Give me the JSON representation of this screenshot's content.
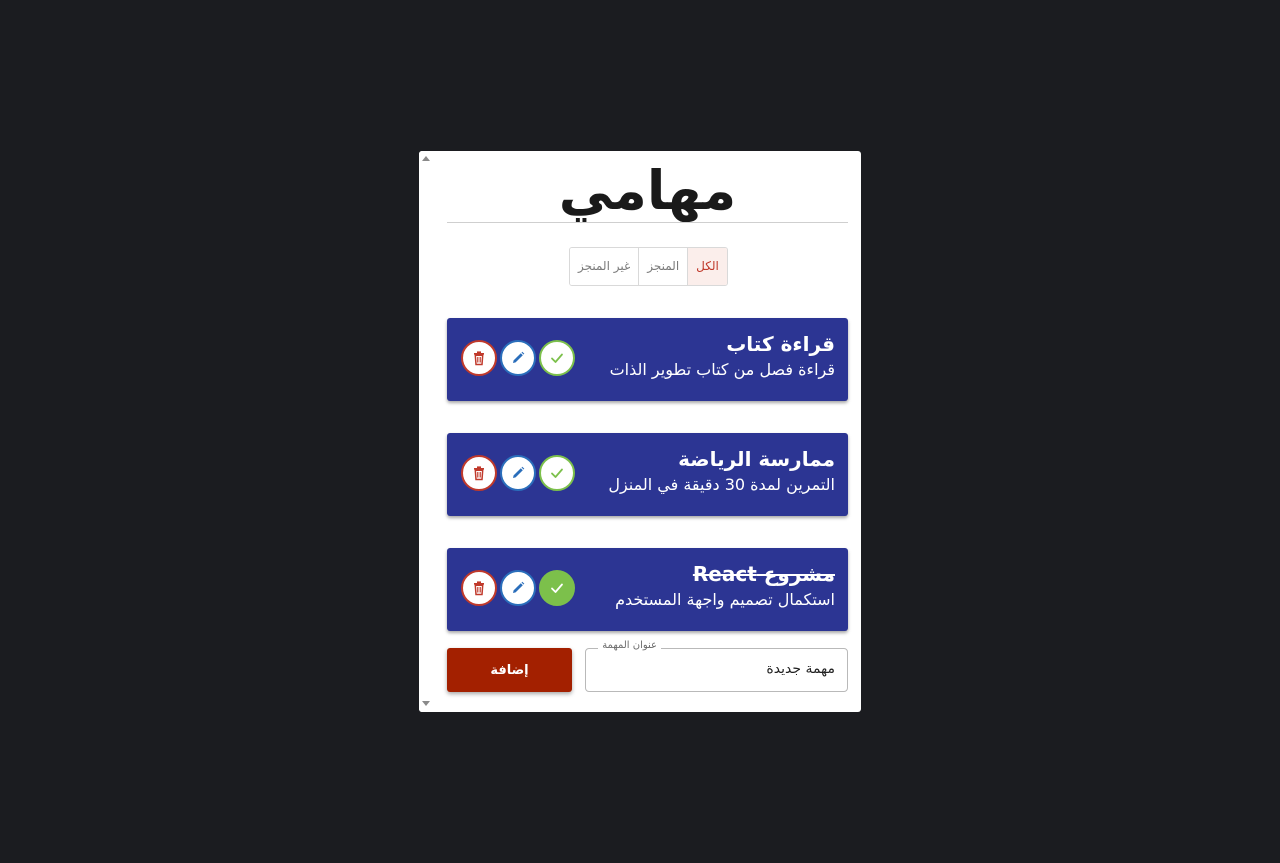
{
  "app": {
    "title": "مهامي"
  },
  "filters": [
    {
      "label": "الكل",
      "active": true
    },
    {
      "label": "المنجز",
      "active": false
    },
    {
      "label": "غير المنجز",
      "active": false
    }
  ],
  "tasks": [
    {
      "title": "قراءة كتاب",
      "description": "قراءة فصل من كتاب تطوير الذات",
      "completed": false
    },
    {
      "title": "ممارسة الرياضة",
      "description": "التمرين لمدة 30 دقيقة في المنزل",
      "completed": false
    },
    {
      "title": "مشروع React",
      "description": "استكمال تصميم واجهة المستخدم",
      "completed": true
    }
  ],
  "form": {
    "field_label": "عنوان المهمة",
    "field_value": "مهمة جديدة",
    "add_label": "إضافة"
  },
  "colors": {
    "task_bg": "#2c3593",
    "accent_red": "#a32000",
    "edit_blue": "#2a6ebb",
    "done_green": "#7cc04b"
  },
  "icons": {
    "delete": "trash-icon",
    "edit": "pencil-icon",
    "complete": "check-icon"
  }
}
